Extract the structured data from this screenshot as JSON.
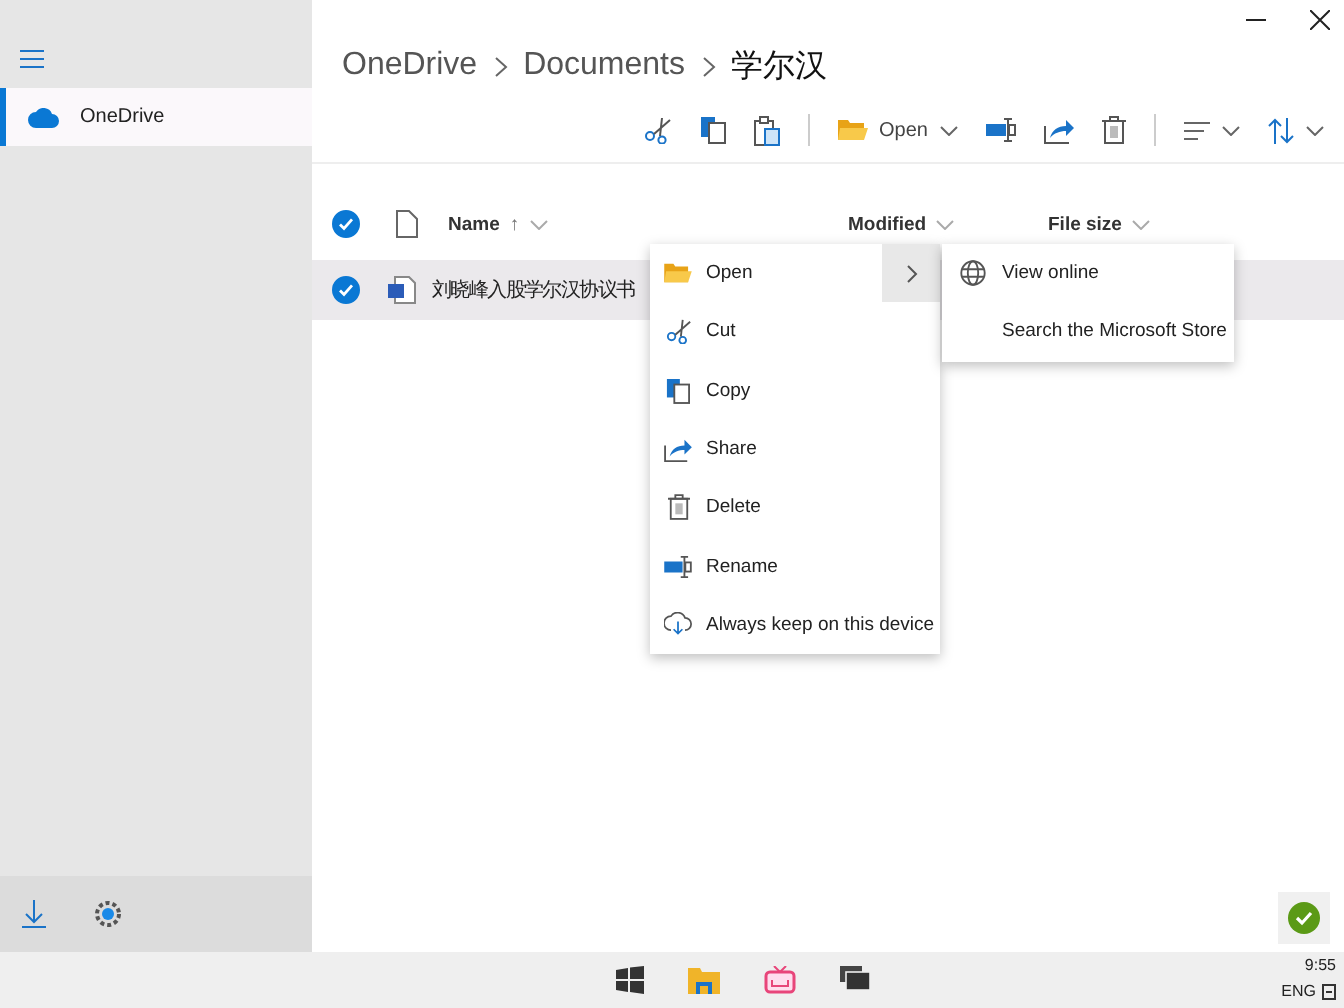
{
  "breadcrumb": [
    "OneDrive",
    "Documents",
    "学尔汉"
  ],
  "sidebar": {
    "items": [
      {
        "label": "OneDrive",
        "selected": true
      }
    ]
  },
  "toolbar": {
    "open_label": "Open"
  },
  "table": {
    "all_checked": true,
    "columns": [
      {
        "label": "Name",
        "sort_indicator": "↑"
      },
      {
        "label": "Modified"
      },
      {
        "label": "File size"
      }
    ],
    "rows": [
      {
        "name": "刘晓峰入股学尔汉协议书",
        "selected": true
      }
    ]
  },
  "context_menu": {
    "items": [
      {
        "label": "Open",
        "expanded": true
      },
      {
        "label": "Cut"
      },
      {
        "label": "Copy"
      },
      {
        "label": "Share"
      },
      {
        "label": "Delete"
      },
      {
        "label": "Rename"
      },
      {
        "label": "Always keep on this device"
      }
    ]
  },
  "submenu": {
    "items": [
      {
        "label": "View online"
      },
      {
        "label": "Search the Microsoft Store"
      }
    ]
  },
  "taskbar": {
    "time": "9:55",
    "language": "ENG"
  }
}
